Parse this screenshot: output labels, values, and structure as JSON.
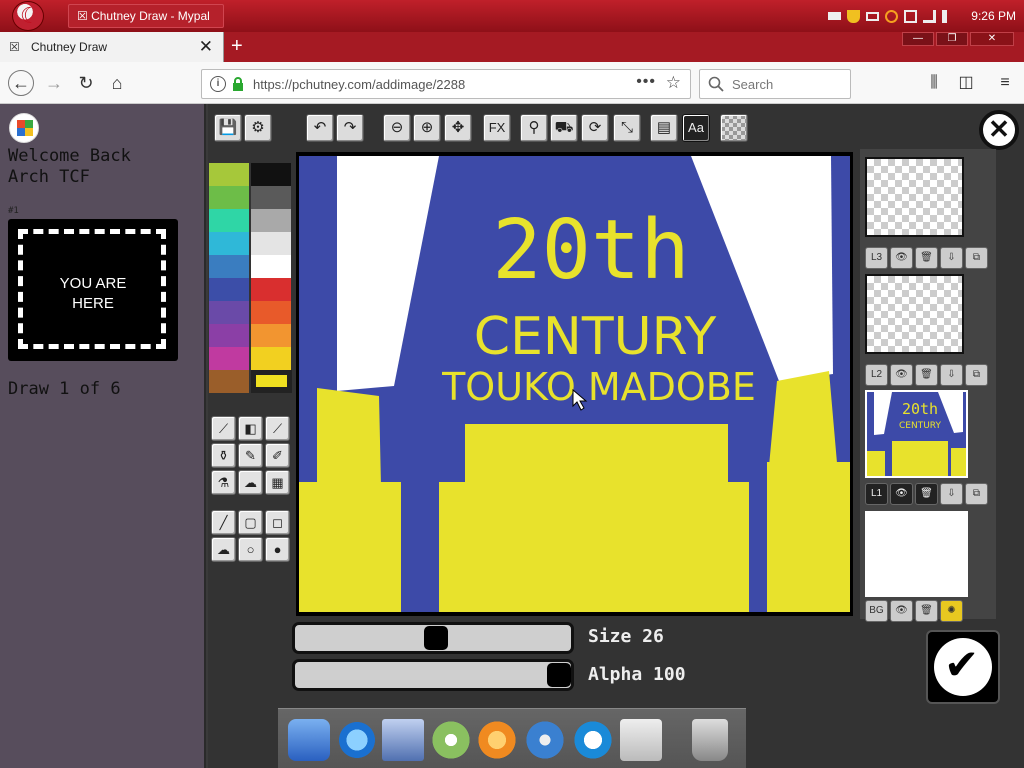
{
  "os": {
    "window_title": "Chutney Draw - Mypal",
    "clock": "9:26 PM"
  },
  "browser": {
    "tab_title": "Chutney Draw",
    "url": "https://pchutney.com/addimage/2288",
    "search_placeholder": "Search",
    "menu_dots": "•••"
  },
  "sidebar": {
    "welcome_line1": "Welcome Back",
    "welcome_line2": "Arch TCF",
    "slot_number": "#1",
    "slot_label_line1": "YOU ARE",
    "slot_label_line2": "HERE",
    "draw_progress": "Draw 1 of 6"
  },
  "toolbar": {
    "fx_label": "FX",
    "text_label": "Aa"
  },
  "palette": {
    "colors": [
      "#a6c83a",
      "#111111",
      "#6dbd48",
      "#5a5a5a",
      "#2fd6a6",
      "#a9a9a9",
      "#2fb8d8",
      "#e4e4e4",
      "#3a7dc0",
      "#ffffff",
      "#3c4ea8",
      "#d92f2f",
      "#6a4aa8",
      "#e85a2a",
      "#8b3fa6",
      "#f29530",
      "#c03aa0",
      "#f2d020",
      "#9a5e2a"
    ],
    "current_color": "#f0e020"
  },
  "canvas": {
    "line1": "20th",
    "line2": "CENTURY",
    "line3": "TOUKO MADOBE",
    "background": "#3d4aa8",
    "foreground": "#e8e22c"
  },
  "layers": [
    {
      "id": "L3",
      "thumb": "transparent"
    },
    {
      "id": "L2",
      "thumb": "transparent"
    },
    {
      "id": "L1",
      "thumb": "image",
      "text1": "20th",
      "text2": "CENTURY"
    },
    {
      "id": "BG",
      "thumb": "white"
    }
  ],
  "brush": {
    "size_label": "Size 26",
    "alpha_label": "Alpha 100",
    "size": 26,
    "alpha": 100
  }
}
